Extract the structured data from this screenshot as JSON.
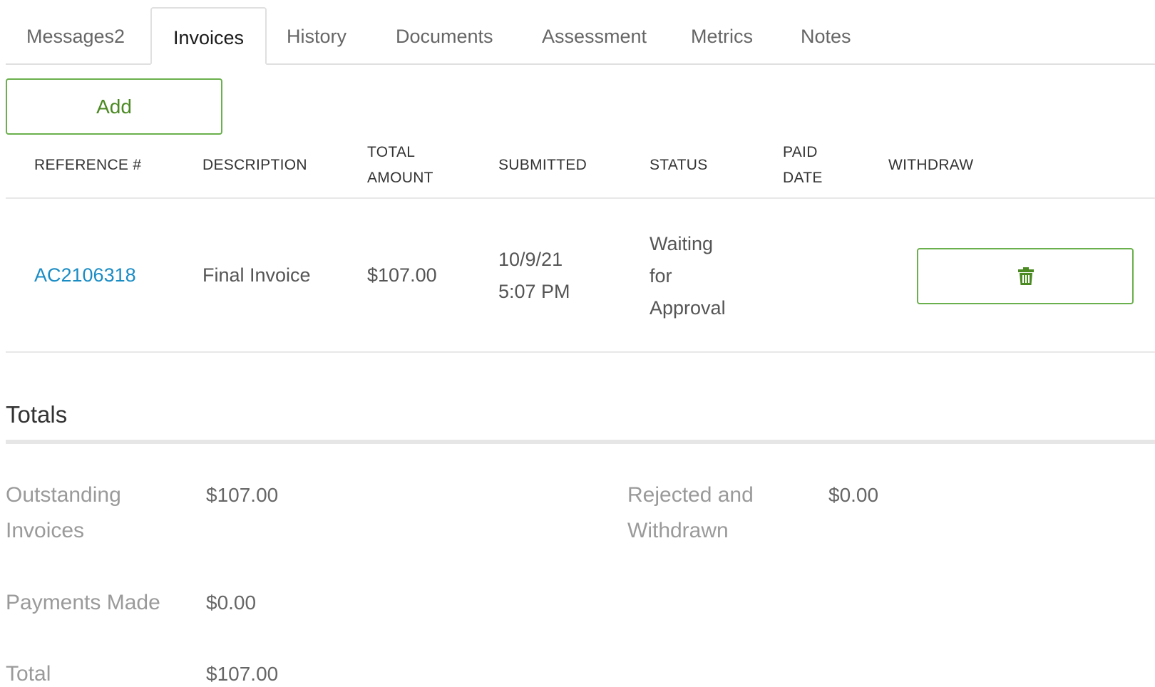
{
  "tabs": [
    {
      "label": "Messages2",
      "active": false
    },
    {
      "label": "Invoices",
      "active": true
    },
    {
      "label": "History",
      "active": false
    },
    {
      "label": "Documents",
      "active": false
    },
    {
      "label": "Assessment",
      "active": false
    },
    {
      "label": "Metrics",
      "active": false
    },
    {
      "label": "Notes",
      "active": false
    }
  ],
  "toolbar": {
    "add_label": "Add"
  },
  "table": {
    "headers": {
      "reference": "REFERENCE #",
      "description": "DESCRIPTION",
      "total_amount_1": "TOTAL",
      "total_amount_2": "AMOUNT",
      "submitted": "SUBMITTED",
      "status": "STATUS",
      "paid_date_1": "PAID",
      "paid_date_2": "DATE",
      "withdraw": "WITHDRAW"
    },
    "rows": [
      {
        "reference": "AC2106318",
        "description": "Final Invoice",
        "total_amount": "$107.00",
        "submitted_date": "10/9/21",
        "submitted_time": "5:07 PM",
        "status_1": "Waiting",
        "status_2": "for",
        "status_3": "Approval",
        "paid_date": "",
        "withdraw_icon": "trash-icon"
      }
    ]
  },
  "totals": {
    "title": "Totals",
    "outstanding_label_1": "Outstanding",
    "outstanding_label_2": "Invoices",
    "outstanding_value": "$107.00",
    "rejected_label_1": "Rejected and",
    "rejected_label_2": "Withdrawn",
    "rejected_value": "$0.00",
    "payments_label": "Payments Made",
    "payments_value": "$0.00",
    "total_label": "Total",
    "total_value": "$107.00"
  },
  "colors": {
    "accent_green": "#6ab04c",
    "link_blue": "#1a8cc4",
    "icon_green": "#4b8a22"
  }
}
